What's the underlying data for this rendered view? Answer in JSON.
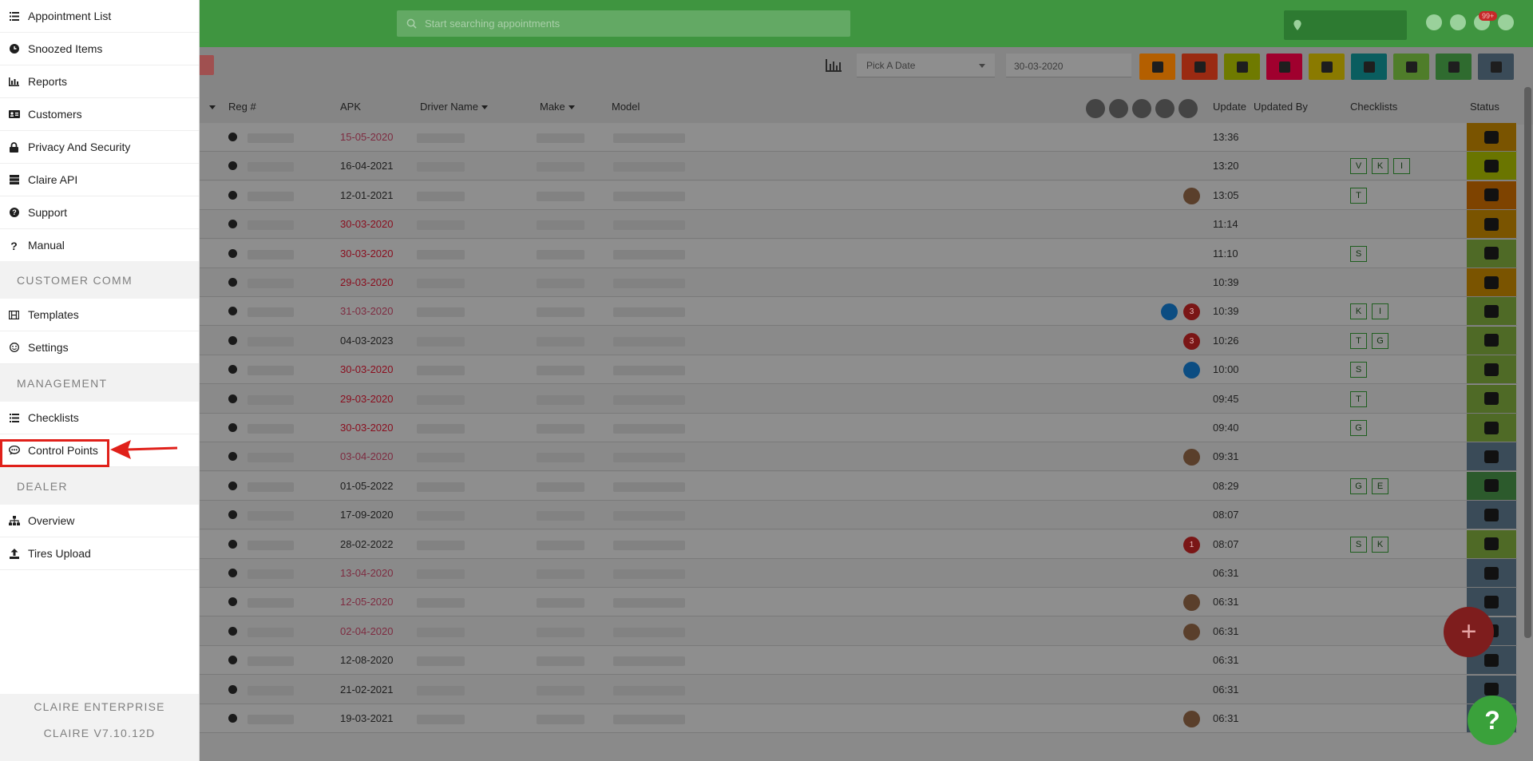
{
  "header": {
    "search_placeholder": "Start searching appointments",
    "notif_badge": "99+"
  },
  "toolbar": {
    "date_picker": "Pick A Date",
    "date_value": "30-03-2020",
    "filter_colors": [
      "#b45f00",
      "#9a2a12",
      "#6f7a00",
      "#a0002e",
      "#8a7a00",
      "#0a5d5f",
      "#4f7d2a",
      "#2f6b2f",
      "#3a4b58"
    ]
  },
  "table": {
    "headers": {
      "reg": "Reg #",
      "apk": "APK",
      "driver": "Driver Name",
      "make": "Make",
      "model": "Model",
      "update": "Update",
      "updated_by": "Updated By",
      "checklists": "Checklists",
      "status": "Status"
    },
    "rows": [
      {
        "apk": "15-05-2020",
        "apk_color": "#7e2c41",
        "update": "13:36",
        "checks": [],
        "icons": [],
        "status": "#7a5400"
      },
      {
        "apk": "16-04-2021",
        "apk_color": "#1e1e1e",
        "update": "13:20",
        "checks": [
          "V",
          "K",
          "I"
        ],
        "icons": [],
        "status": "#6a7500"
      },
      {
        "apk": "12-01-2021",
        "apk_color": "#1e1e1e",
        "update": "13:05",
        "checks": [
          "T"
        ],
        "icons": [
          {
            "c": "#5a3f2b",
            "t": ""
          }
        ],
        "status": "#7e4300"
      },
      {
        "apk": "30-03-2020",
        "apk_color": "#8a0e1e",
        "update": "11:14",
        "checks": [],
        "icons": [],
        "status": "#7a5400"
      },
      {
        "apk": "30-03-2020",
        "apk_color": "#8a0e1e",
        "update": "11:10",
        "checks": [
          "S"
        ],
        "icons": [],
        "status": "#4f6a26"
      },
      {
        "apk": "29-03-2020",
        "apk_color": "#8a0e1e",
        "update": "10:39",
        "checks": [],
        "icons": [],
        "status": "#7a5400"
      },
      {
        "apk": "31-03-2020",
        "apk_color": "#7e2c41",
        "update": "10:39",
        "checks": [
          "K",
          "I"
        ],
        "icons": [
          {
            "c": "#0c4d82",
            "t": ""
          },
          {
            "c": "#7a1616",
            "t": "3"
          }
        ],
        "status": "#4f6a26"
      },
      {
        "apk": "04-03-2023",
        "apk_color": "#1e1e1e",
        "update": "10:26",
        "checks": [
          "T",
          "G"
        ],
        "icons": [
          {
            "c": "#7a1616",
            "t": "3"
          }
        ],
        "status": "#4f6a26"
      },
      {
        "apk": "30-03-2020",
        "apk_color": "#8a0e1e",
        "update": "10:00",
        "checks": [
          "S"
        ],
        "icons": [
          {
            "c": "#0c4d82",
            "t": ""
          }
        ],
        "status": "#4f6a26"
      },
      {
        "apk": "29-03-2020",
        "apk_color": "#8a0e1e",
        "update": "09:45",
        "checks": [
          "T"
        ],
        "icons": [],
        "status": "#4f6a26"
      },
      {
        "apk": "30-03-2020",
        "apk_color": "#8a0e1e",
        "update": "09:40",
        "checks": [
          "G"
        ],
        "icons": [],
        "status": "#4f6a26"
      },
      {
        "apk": "03-04-2020",
        "apk_color": "#7e2c41",
        "update": "09:31",
        "checks": [],
        "icons": [
          {
            "c": "#5a3f2b",
            "t": ""
          }
        ],
        "status": "#3a4b58"
      },
      {
        "apk": "01-05-2022",
        "apk_color": "#1e1e1e",
        "update": "08:29",
        "checks": [
          "G",
          "E"
        ],
        "icons": [],
        "status": "#2c5a2c"
      },
      {
        "apk": "17-09-2020",
        "apk_color": "#1e1e1e",
        "update": "08:07",
        "checks": [],
        "icons": [],
        "status": "#3a4b58"
      },
      {
        "apk": "28-02-2022",
        "apk_color": "#1e1e1e",
        "update": "08:07",
        "checks": [
          "S",
          "K"
        ],
        "icons": [
          {
            "c": "#7a1616",
            "t": "1"
          }
        ],
        "status": "#4f6a26"
      },
      {
        "apk": "13-04-2020",
        "apk_color": "#7e2c41",
        "update": "06:31",
        "checks": [],
        "icons": [],
        "status": "#3a4b58"
      },
      {
        "apk": "12-05-2020",
        "apk_color": "#7e2c41",
        "update": "06:31",
        "checks": [],
        "icons": [
          {
            "c": "#5a3f2b",
            "t": ""
          }
        ],
        "status": "#3a4b58"
      },
      {
        "apk": "02-04-2020",
        "apk_color": "#7e2c41",
        "update": "06:31",
        "checks": [],
        "icons": [
          {
            "c": "#5a3f2b",
            "t": ""
          }
        ],
        "status": "#3a4b58"
      },
      {
        "apk": "12-08-2020",
        "apk_color": "#1e1e1e",
        "update": "06:31",
        "checks": [],
        "icons": [],
        "status": "#3a4b58"
      },
      {
        "apk": "21-02-2021",
        "apk_color": "#1e1e1e",
        "update": "06:31",
        "checks": [],
        "icons": [],
        "status": "#3a4b58"
      },
      {
        "apk": "19-03-2021",
        "apk_color": "#1e1e1e",
        "update": "06:31",
        "checks": [],
        "icons": [
          {
            "c": "#5a3f2b",
            "t": ""
          }
        ],
        "status": "#3a4b58"
      }
    ]
  },
  "drawer": {
    "items": [
      {
        "label": "Appointment List",
        "icon": "list-icon"
      },
      {
        "label": "Snoozed Items",
        "icon": "clock-icon"
      },
      {
        "label": "Reports",
        "icon": "bar-chart-icon"
      },
      {
        "label": "Customers",
        "icon": "id-card-icon"
      },
      {
        "label": "Privacy And Security",
        "icon": "lock-icon"
      },
      {
        "label": "Claire API",
        "icon": "server-icon"
      },
      {
        "label": "Support",
        "icon": "question-circle-icon"
      },
      {
        "label": "Manual",
        "icon": "question-mark-icon"
      }
    ],
    "section_comm": "CUSTOMER COMM",
    "comm_items": [
      {
        "label": "Templates",
        "icon": "film-icon"
      },
      {
        "label": "Settings",
        "icon": "smile-icon"
      }
    ],
    "section_management": "MANAGEMENT",
    "management_items": [
      {
        "label": "Checklists",
        "icon": "list-icon"
      },
      {
        "label": "Control Points",
        "icon": "comment-dots-icon"
      }
    ],
    "section_dealer": "DEALER",
    "dealer_items": [
      {
        "label": "Overview",
        "icon": "sitemap-icon"
      },
      {
        "label": "Tires Upload",
        "icon": "upload-icon"
      }
    ],
    "footer_line1": "CLAIRE ENTERPRISE",
    "footer_line2": "CLAIRE V7.10.12D"
  }
}
